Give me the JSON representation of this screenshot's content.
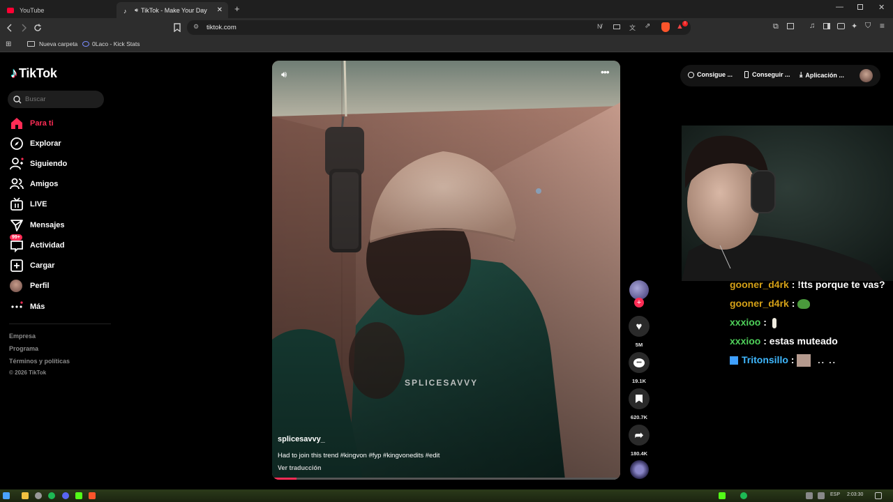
{
  "browser": {
    "tabs": [
      {
        "label": "YouTube",
        "active": false
      },
      {
        "label": "TikTok - Make Your Day",
        "active": true
      }
    ],
    "new_tab": "+",
    "url": "tiktok.com",
    "bookmarks": [
      {
        "label": "Nueva carpeta"
      },
      {
        "label": "0Laco - Kick Stats"
      }
    ],
    "shield_badge": "!"
  },
  "sidebar": {
    "logo": "TikTok",
    "search_placeholder": "Buscar",
    "items": [
      {
        "label": "Para ti",
        "icon": "home-icon",
        "active": true
      },
      {
        "label": "Explorar",
        "icon": "compass-icon"
      },
      {
        "label": "Siguiendo",
        "icon": "following-icon"
      },
      {
        "label": "Amigos",
        "icon": "friends-icon"
      },
      {
        "label": "LIVE",
        "icon": "live-icon"
      },
      {
        "label": "Mensajes",
        "icon": "messages-icon"
      },
      {
        "label": "Actividad",
        "icon": "activity-icon",
        "badge": "99+"
      },
      {
        "label": "Cargar",
        "icon": "upload-icon"
      },
      {
        "label": "Perfil",
        "icon": "profile-avatar"
      },
      {
        "label": "Más",
        "icon": "more-icon"
      }
    ],
    "footer": [
      "Empresa",
      "Programa",
      "Términos y políticas",
      "© 2026 TikTok"
    ]
  },
  "video": {
    "username": "splicesavvy_",
    "caption": "Had to join this trend #kingvon #fyp #kingvonedits #edit",
    "translate": "Ver traducción",
    "watermark": "SPLICESAVVY"
  },
  "actions": {
    "likes": "5M",
    "comments": "19.1K",
    "saves": "620.7K",
    "shares": "180.4K"
  },
  "topbar": {
    "buttons": [
      "Consigue ...",
      "Conseguir ...",
      "Aplicación ..."
    ]
  },
  "chat": [
    {
      "user": "gooner_d4rk",
      "message": " : !tts porque te vas?",
      "color": "#d4a017"
    },
    {
      "user": "gooner_d4rk",
      "message": " : ",
      "emote": "pepe",
      "color": "#d4a017"
    },
    {
      "user": "xxxioo",
      "message": " : ",
      "emote": "bone",
      "color": "#4fd05a"
    },
    {
      "user": "xxxioo",
      "message": " : estas muteado",
      "color": "#4fd05a"
    },
    {
      "user": "Tritonsillo",
      "message": " : ",
      "emote": "face",
      "color": "#3fb8ff",
      "dots": ".. .."
    }
  ],
  "taskbar": {
    "lang": "ESP",
    "time": "2:03:30"
  }
}
